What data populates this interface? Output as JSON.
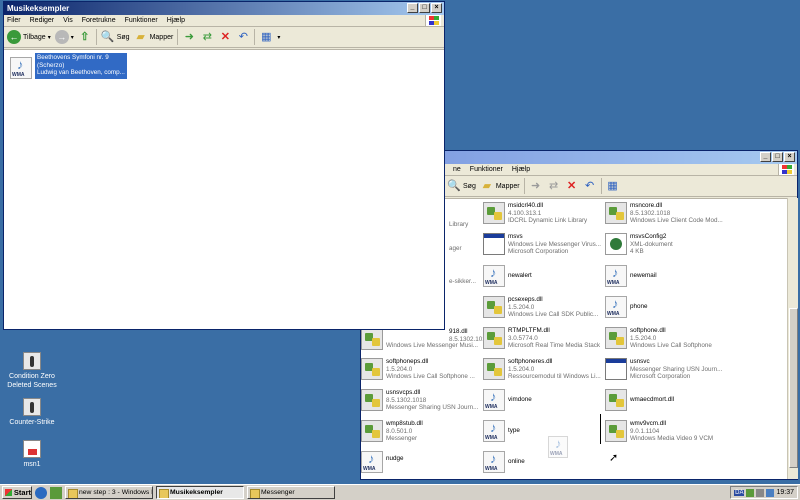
{
  "colors": {
    "titlebar_active": "#0a246a",
    "titlebar_inactive": "#7a96df",
    "desktop": "#3a6ea5",
    "selection": "#316ac5"
  },
  "desktop": {
    "icons": [
      {
        "label": "Condition Zero Deleted Scenes",
        "icon": "counter-strike-icon"
      },
      {
        "label": "Counter-Strike",
        "icon": "counter-strike-icon"
      },
      {
        "label": "msn1",
        "icon": "msn-shortcut-icon"
      }
    ]
  },
  "win_front": {
    "title": "Musikeksempler",
    "menu": [
      "Filer",
      "Rediger",
      "Vis",
      "Foretrukne",
      "Funktioner",
      "Hjælp"
    ],
    "toolbar": {
      "back": "Tilbage",
      "search": "Søg",
      "folders": "Mapper"
    },
    "file": {
      "name": "Beethovens Symfoni nr. 9",
      "line2": "(Scherzo)",
      "line3": "Ludwig van Beethoven, comp..."
    }
  },
  "win_back": {
    "menu": [
      "ne",
      "Funktioner",
      "Hjælp"
    ],
    "toolbar": {
      "search": "Søg",
      "folders": "Mapper"
    },
    "partial": {
      "library": "Library",
      "ager": "ager",
      "sikker": "e-sikker...",
      "dll_918": "918.dll",
      "ver_918": "8.5.1302.1018",
      "company_918": "Windows Live Messenger Musi..."
    },
    "files": [
      {
        "name": "msidcrl40.dll",
        "ver": "4.100.313.1",
        "desc": "IDCRL Dynamic Link Library",
        "type": "dll"
      },
      {
        "name": "msncore.dll",
        "ver": "8.5.1302.1018",
        "desc": "Windows Live Client Code Mod...",
        "type": "dll"
      },
      {
        "name": "msvs",
        "ver": "Windows Live Messenger Virus...",
        "desc": "Microsoft Corporation",
        "type": "exe"
      },
      {
        "name": "msvsConfig2",
        "ver": "XML-dokument",
        "desc": "4 KB",
        "type": "xml"
      },
      {
        "name": "newalert",
        "ver": "",
        "desc": "",
        "type": "wma"
      },
      {
        "name": "newemail",
        "ver": "",
        "desc": "",
        "type": "wma"
      },
      {
        "name": "pcsexeps.dll",
        "ver": "1.5.204.0",
        "desc": "Windows Live Call SDK Public...",
        "type": "dll"
      },
      {
        "name": "phone",
        "ver": "",
        "desc": "",
        "type": "wma"
      },
      {
        "name": "RTMPLTFM.dll",
        "ver": "3.0.5774.0",
        "desc": "Microsoft Real Time Media Stack",
        "type": "dll"
      },
      {
        "name": "softphone.dll",
        "ver": "1.5.204.0",
        "desc": "Windows Live Call Softphone",
        "type": "dll"
      },
      {
        "name": "softphoneps.dll",
        "ver": "1.5.204.0",
        "desc": "Windows Live Call Softphone ...",
        "type": "dll"
      },
      {
        "name": "softphoneres.dll",
        "ver": "1.5.204.0",
        "desc": "Ressourcemodul til Windows Li...",
        "type": "dll"
      },
      {
        "name": "usnsvc",
        "ver": "Messenger Sharing USN Journ...",
        "desc": "Microsoft Corporation",
        "type": "exe"
      },
      {
        "name": "usnsvcps.dll",
        "ver": "8.5.1302.1018",
        "desc": "Messenger Sharing USN Journ...",
        "type": "dll"
      },
      {
        "name": "vimdone",
        "ver": "",
        "desc": "",
        "type": "wma"
      },
      {
        "name": "wmaecdmort.dll",
        "ver": "",
        "desc": "",
        "type": "dll"
      },
      {
        "name": "wmp8stub.dll",
        "ver": "8.0.501.0",
        "desc": "Messenger",
        "type": "dll"
      },
      {
        "name": "type",
        "ver": "",
        "desc": "",
        "type": "wma"
      },
      {
        "name": "wmv9vcm.dll",
        "ver": "9.0.1.1104",
        "desc": "Windows Media Video 9 VCM",
        "type": "dll"
      },
      {
        "name": "nudge",
        "ver": "",
        "desc": "",
        "type": "wma"
      },
      {
        "name": "online",
        "ver": "",
        "desc": "",
        "type": "wma"
      }
    ]
  },
  "taskbar": {
    "start": "Start",
    "tasks": [
      "new step : 3 - Windows I...",
      "Musikeksempler",
      "Messenger"
    ],
    "lang": "DA",
    "clock": "19:37"
  }
}
